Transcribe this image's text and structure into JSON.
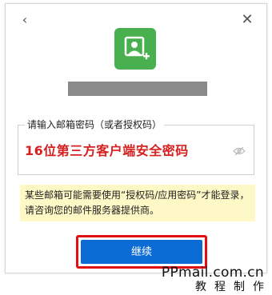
{
  "header": {
    "back_glyph": "‹",
    "close_glyph": "✕"
  },
  "app_icon": {
    "name": "add-contact-icon",
    "color": "#48b04e"
  },
  "password": {
    "legend": "请输入邮箱密码（或者授权码）",
    "value": "16位第三方客户端安全密码",
    "value_color": "#d6201f",
    "eye_icon": "eye-slash-icon"
  },
  "notice": {
    "text": "某些邮箱可能需要使用“授权码/应用密码”才能登录，请咨询您的邮件服务器提供商。",
    "background": "#fdf8c6"
  },
  "continue_button": {
    "label": "继续",
    "background": "#0b6cd6",
    "highlight_color": "#e10f10"
  },
  "watermark": {
    "site": "PPmail.com.cn",
    "subtitle": "教程制作"
  }
}
